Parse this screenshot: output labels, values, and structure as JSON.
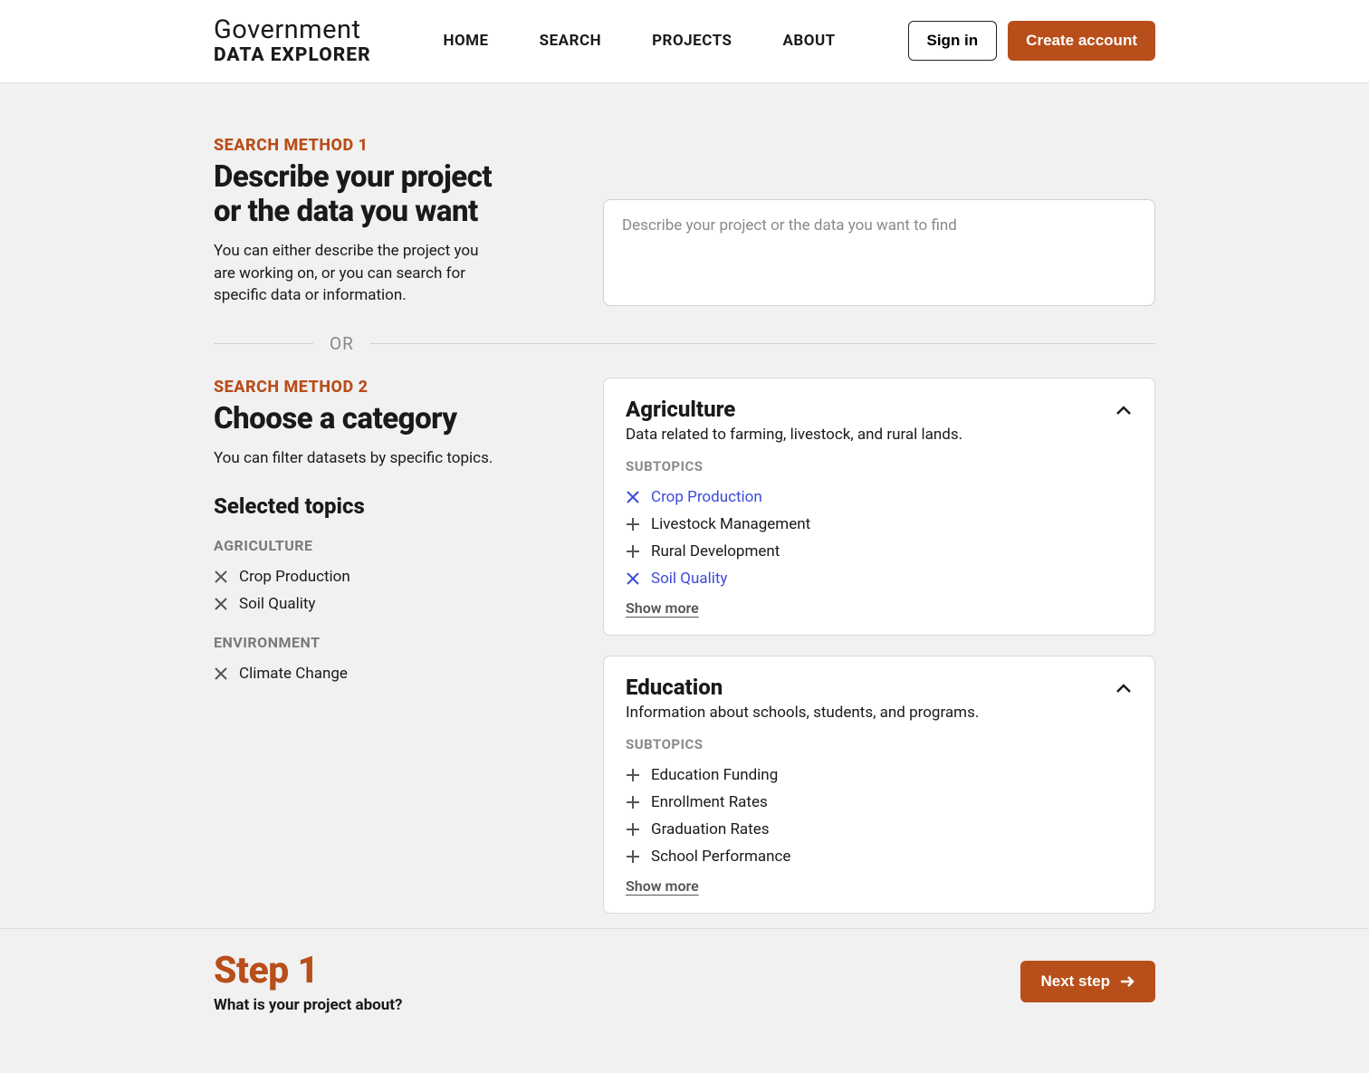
{
  "header": {
    "logo_top": "Government",
    "logo_bottom": "DATA EXPLORER",
    "nav": [
      "HOME",
      "SEARCH",
      "PROJECTS",
      "ABOUT"
    ],
    "sign_in": "Sign in",
    "create_account": "Create account"
  },
  "method1": {
    "label": "SEARCH METHOD 1",
    "heading": "Describe your project or the data you want",
    "desc": "You can either describe the project you are working on, or you can search for specific data or information.",
    "placeholder": "Describe your project or the data you want to find"
  },
  "divider": "OR",
  "method2": {
    "label": "SEARCH METHOD 2",
    "heading": "Choose a category",
    "desc": "You can filter datasets by specific topics.",
    "selected_heading": "Selected topics",
    "groups": [
      {
        "label": "AGRICULTURE",
        "items": [
          "Crop Production",
          "Soil Quality"
        ]
      },
      {
        "label": "ENVIRONMENT",
        "items": [
          "Climate Change"
        ]
      }
    ]
  },
  "categories": [
    {
      "title": "Agriculture",
      "desc": "Data related to farming, livestock, and rural lands.",
      "subtopics_label": "SUBTOPICS",
      "subtopics": [
        {
          "name": "Crop Production",
          "selected": true
        },
        {
          "name": "Livestock Management",
          "selected": false
        },
        {
          "name": "Rural Development",
          "selected": false
        },
        {
          "name": "Soil Quality",
          "selected": true
        }
      ],
      "show_more": "Show more"
    },
    {
      "title": "Education",
      "desc": "Information about schools, students, and programs.",
      "subtopics_label": "SUBTOPICS",
      "subtopics": [
        {
          "name": "Education Funding",
          "selected": false
        },
        {
          "name": "Enrollment Rates",
          "selected": false
        },
        {
          "name": "Graduation Rates",
          "selected": false
        },
        {
          "name": "School Performance",
          "selected": false
        }
      ],
      "show_more": "Show more"
    }
  ],
  "footer": {
    "step": "Step 1",
    "question": "What is your project about?",
    "next": "Next step"
  }
}
